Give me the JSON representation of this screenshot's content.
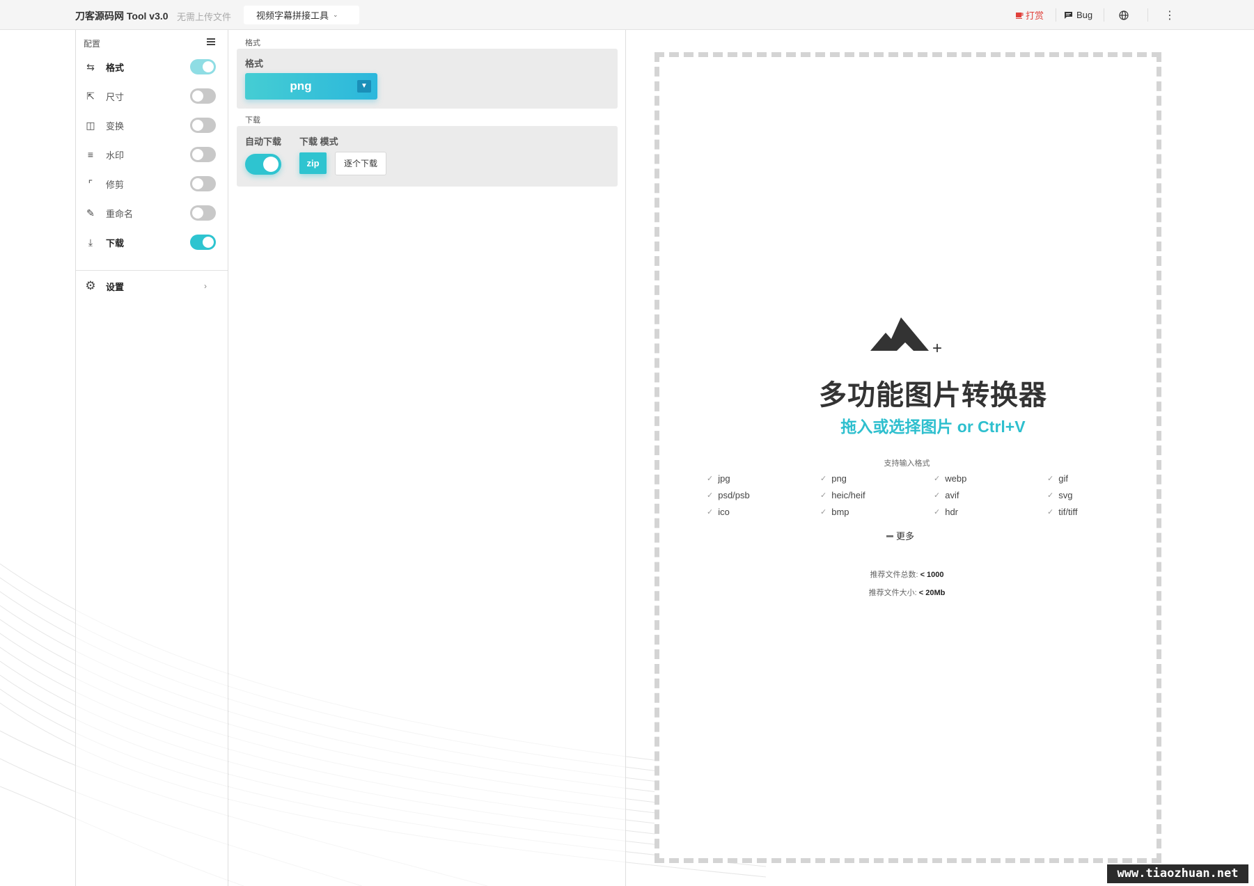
{
  "header": {
    "brand": "刀客源码网 Tool v3.0",
    "brand_sub": "无需上传文件",
    "tool_select": "视频字幕拼接工具",
    "donate": "打赏",
    "bug": "Bug"
  },
  "sidebar": {
    "title": "配置",
    "items": [
      {
        "label": "格式",
        "icon": "swap-icon",
        "enabled": true
      },
      {
        "label": "尺寸",
        "icon": "resize-icon",
        "enabled": false
      },
      {
        "label": "变换",
        "icon": "transform-icon",
        "enabled": false
      },
      {
        "label": "水印",
        "icon": "watermark-icon",
        "enabled": false
      },
      {
        "label": "修剪",
        "icon": "crop-icon",
        "enabled": false
      },
      {
        "label": "重命名",
        "icon": "rename-icon",
        "enabled": false
      },
      {
        "label": "下载",
        "icon": "download-icon",
        "enabled": true
      }
    ],
    "settings_label": "设置"
  },
  "middle": {
    "format_section": "格式",
    "format_label": "格式",
    "format_value": "png",
    "download_section": "下载",
    "auto_download_label": "自动下载",
    "download_mode_label": "下载 模式",
    "zip_label": "zip",
    "single_label": "逐个下载"
  },
  "dropzone": {
    "title": "多功能图片转换器",
    "subtitle": "拖入或选择图片 or Ctrl+V",
    "support_label": "支持输入格式",
    "formats": [
      "jpg",
      "png",
      "webp",
      "gif",
      "psd/psb",
      "heic/heif",
      "avif",
      "svg",
      "ico",
      "bmp",
      "hdr",
      "tif/tiff"
    ],
    "more_label": "更多",
    "rec_count_label": "推荐文件总数:",
    "rec_count_value": "< 1000",
    "rec_size_label": "推荐文件大小:",
    "rec_size_value": "< 20Mb"
  },
  "watermark": "www.tiaozhuan.net",
  "colors": {
    "accent": "#2ec4d0",
    "donate": "#e0403a"
  }
}
